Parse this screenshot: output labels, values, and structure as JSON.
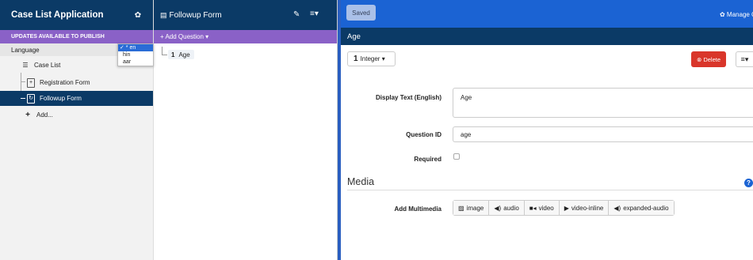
{
  "sidebar": {
    "app_title": "Case List Application",
    "updates_banner": "UPDATES AVAILABLE TO PUBLISH",
    "language_label": "Language",
    "language_options": [
      {
        "label": "✓ * en",
        "selected": true
      },
      {
        "label": "hin",
        "selected": false
      },
      {
        "label": "aar",
        "selected": false
      }
    ],
    "items": [
      {
        "label": "Case List"
      },
      {
        "label": "Registration Form"
      },
      {
        "label": "Followup Form"
      },
      {
        "label": "Add..."
      }
    ]
  },
  "form_panel": {
    "title": "Followup Form",
    "add_question": "+ Add Question ▾",
    "questions": [
      {
        "num": "1",
        "label": "Age"
      }
    ]
  },
  "editor": {
    "saved_label": "Saved",
    "manage_label": "✿ Manage Case",
    "question_title": "Age",
    "type_num": "1",
    "type_label": "Integer ▾",
    "delete_label": "⊗ Delete",
    "more_label": "≡▾",
    "display_text_label": "Display Text (English)",
    "display_text_value": "Age",
    "question_id_label": "Question ID",
    "question_id_value": "age",
    "required_label": "Required",
    "media_heading": "Media",
    "add_multimedia_label": "Add Multimedia",
    "media_buttons": [
      {
        "icon": "image-icon",
        "glyph": "▨",
        "label": "image"
      },
      {
        "icon": "audio-icon",
        "glyph": "◀)",
        "label": "audio"
      },
      {
        "icon": "video-icon",
        "glyph": "■◂",
        "label": "video"
      },
      {
        "icon": "play-icon",
        "glyph": "▶",
        "label": "video-inline"
      },
      {
        "icon": "audio-icon",
        "glyph": "◀)",
        "label": "expanded-audio"
      }
    ]
  },
  "colors": {
    "header_navy": "#0b3a66",
    "accent_purple": "#8a61c7",
    "top_bar_blue": "#1b63d3",
    "delete_red": "#d9362a"
  }
}
